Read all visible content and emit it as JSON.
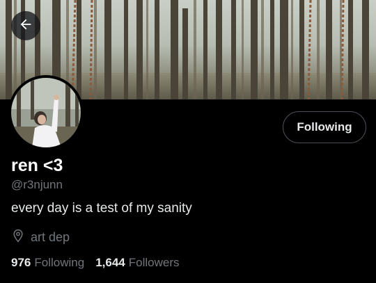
{
  "header": {
    "back_icon": "arrow-left-icon"
  },
  "profile": {
    "display_name": "ren <3",
    "handle": "@r3njunn",
    "bio": "every day is a test of my sanity",
    "location": "art dep",
    "location_icon": "location-pin-icon",
    "follow_button_label": "Following"
  },
  "stats": {
    "following_count": "976",
    "following_label": "Following",
    "followers_count": "1,644",
    "followers_label": "Followers"
  },
  "colors": {
    "background": "#000000",
    "primary_text": "#e7e9ea",
    "secondary_text": "#71767b",
    "button_border": "#4a4f55"
  }
}
